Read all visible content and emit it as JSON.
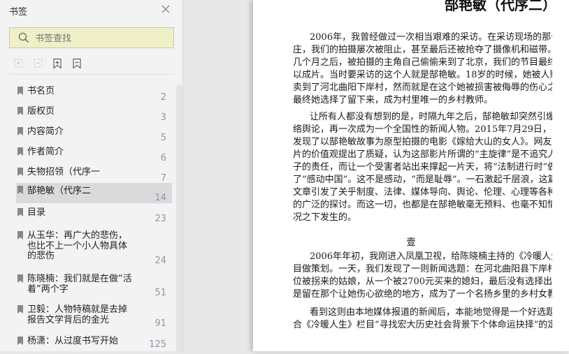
{
  "sidebar": {
    "title": "书签",
    "search_placeholder": "书签查找",
    "toolbar": [
      "expand-all-icon",
      "collapse-all-icon",
      "add-bookmark-icon",
      "remove-bookmark-icon"
    ],
    "items": [
      {
        "label": "书名页",
        "page": "2"
      },
      {
        "label": "版权页",
        "page": "3"
      },
      {
        "label": "内容简介",
        "page": "5"
      },
      {
        "label": "作者简介",
        "page": "6"
      },
      {
        "label": "失物招领（代序一",
        "page": "7"
      },
      {
        "label": "郜艳敏（代序二",
        "page": "14",
        "selected": true
      },
      {
        "label": "目录",
        "page": "23"
      },
      {
        "label": "从玉华：再广大的悲伤，也比不上一个小人物具体的悲伤",
        "page": "24"
      },
      {
        "label": "陈晓楠：我们就是在做“活着”两个字",
        "page": "51"
      },
      {
        "label": "卫毅：人物特稿就是去掉报告文学背后的金光",
        "page": "91"
      },
      {
        "label": "杨潇：从过度书写开始",
        "page": "125"
      }
    ]
  },
  "document": {
    "title": "郜艳敏（代序二）",
    "section": "壹",
    "paragraphs": [
      [
        "2006年，我曾经做过一次相当艰难的采访。在采访现场的那个小村",
        "庄，我们的拍摄屡次被阻止，甚至最后还被抢夺了摄像机和磁带。直到",
        "几个月之后，被拍摄的主角自己偷偷来到了北京，我们的节目最终才得",
        "以成片。当时要采访的这个人就是郜艳敏。18岁的时候，她被人贩子拐",
        "卖到了河北曲阳下岸村，然而就是在这个她被损害被侮辱的伤心之地，",
        "最终她选择了留下来，成为村里唯一的乡村教师。"
      ],
      [
        "让所有人都没有想到的是，时隔九年之后，郜艳敏却突然引爆了网",
        "络舆论，再一次成为一个全国性的新闻人物。2015年7月29日，有网友",
        "发现了以郜艳敏故事为原型拍摄的电影《嫁给大山的女人》。网友对影",
        "片的价值观提出了质疑，认为这部影片所谓的“主旋律”是不追究人贩",
        "子的责任，而让一个受害者站出来撑起一片天，将“法制进行时”做成",
        "了“感动中国”。这不是感动，“而是耻辱”。一石激起千层浪，这篇",
        "文章引发了关乎制度、法律、媒体导向、舆论、伦理、心理等各种层面",
        "的广泛的探讨。而这一切，也都是在郜艳敏毫无预料、也毫不知情的情",
        "况之下发生的。"
      ],
      [
        "2006年年初，我刚进入凤凰卫视，给陈晓楠主持的《冷暖人生》栏",
        "目做策划。一天，我们发现了一则新闻选题：在河北曲阳县下岸村有一",
        "位被拐来的姑娘，从一个被2700元买来的媳妇，最后没有选择出逃，而",
        "是留在那个让她伤心欲绝的地方，成为了一个名扬乡里的乡村女教师。"
      ],
      [
        "看到这则由本地媒体报道的新闻后，本能地觉得是一个好选题，符",
        "合《冷暖人生》栏目“寻找宏大历史社会背景下个体命运抉择”的定"
      ]
    ]
  }
}
